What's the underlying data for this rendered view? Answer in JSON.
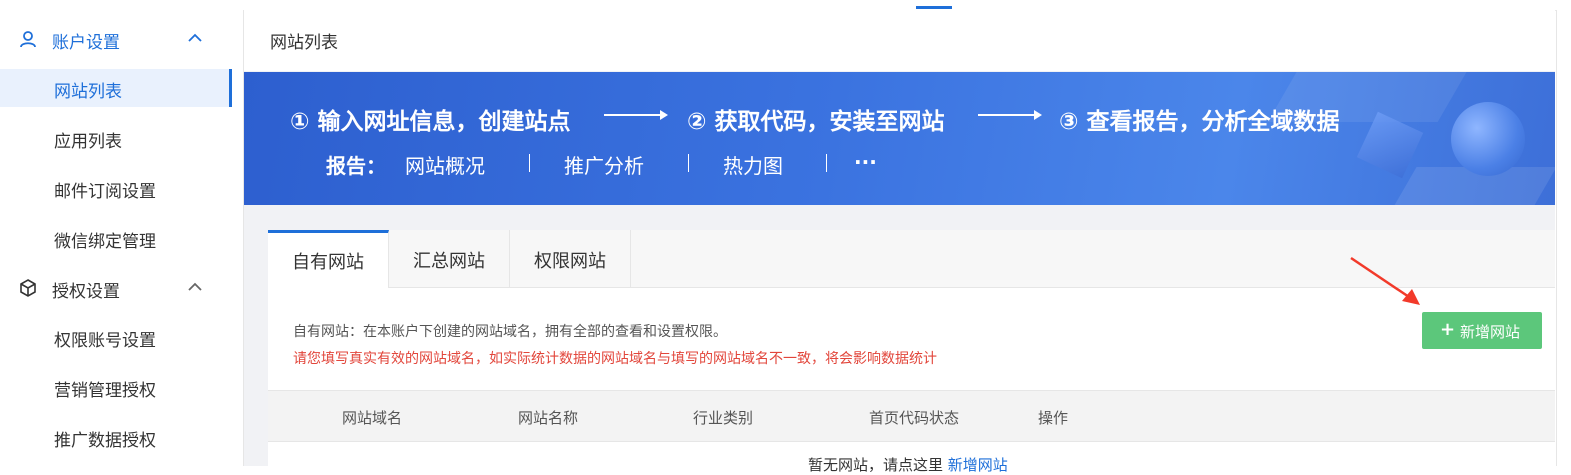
{
  "sidebar": {
    "groups": [
      {
        "label": "账户设置",
        "icon": "user-icon"
      },
      {
        "label": "授权设置",
        "icon": "cube-icon"
      }
    ],
    "account_items": [
      "网站列表",
      "应用列表",
      "邮件订阅设置",
      "微信绑定管理"
    ],
    "auth_items": [
      "权限账号设置",
      "营销管理授权",
      "推广数据授权"
    ]
  },
  "breadcrumb": "网站列表",
  "banner": {
    "steps": [
      "① 输入网址信息，创建站点",
      "② 获取代码，安装至网站",
      "③ 查看报告，分析全域数据"
    ],
    "report_label": "报告：",
    "reports": [
      "网站概况",
      "推广分析",
      "热力图",
      "···"
    ]
  },
  "tabs": [
    "自有网站",
    "汇总网站",
    "权限网站"
  ],
  "description": "自有网站：在本账户下创建的网站域名，拥有全部的查看和设置权限。",
  "warning": "请您填写真实有效的网站域名，如实际统计数据的网站域名与填写的网站域名不一致，将会影响数据统计",
  "add_button": "新增网站",
  "table": {
    "headers": [
      "网站域名",
      "网站名称",
      "行业类别",
      "首页代码状态",
      "操作"
    ]
  },
  "empty": {
    "text": "暂无网站，请点这里",
    "link": "新增网站"
  },
  "colors": {
    "accent": "#1e6fd9",
    "add_button": "#5cc77b",
    "warning": "#e2463b",
    "annotation_arrow": "#f23a2a"
  }
}
